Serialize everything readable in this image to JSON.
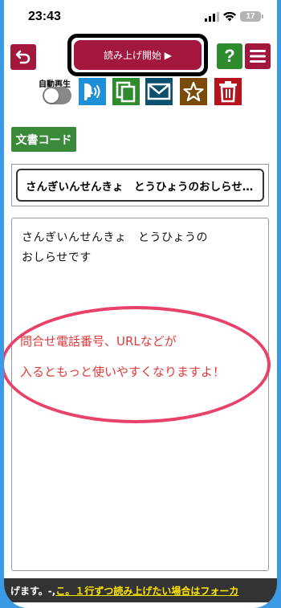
{
  "status_bar": {
    "time": "23:43",
    "battery": "17"
  },
  "toolbar": {
    "back_icon": "back-arrow-icon",
    "read_start_label": "読み上げ開始 ▶",
    "help_label": "?",
    "menu_icon": "hamburger-icon",
    "auto_play_label": "自動再生",
    "auto_play_on": false,
    "actions": [
      "speak-icon",
      "copy-icon",
      "mail-icon",
      "star-icon",
      "trash-icon"
    ]
  },
  "document": {
    "code_button_label": "文書コード",
    "title": "さんぎいんせんきょ　とうひょうのおしらせです",
    "body_line_1": "さんぎいんせんきょ　とうひょうの",
    "body_line_2": "おしらせです"
  },
  "hint": {
    "line_1": "問合せ電話番号、URLなどが",
    "line_2": "入るともっと使いやすくなりますよ！",
    "color": "#e8416a"
  },
  "ticker": {
    "text_prefix": "げます。-,",
    "link_text": "こ。１行ずつ読み上げたい場合はフォーカ"
  },
  "colors": {
    "accent_red": "#a3163e",
    "accent_green": "#2e8b2e",
    "background_blue": "#3b9ae6"
  }
}
